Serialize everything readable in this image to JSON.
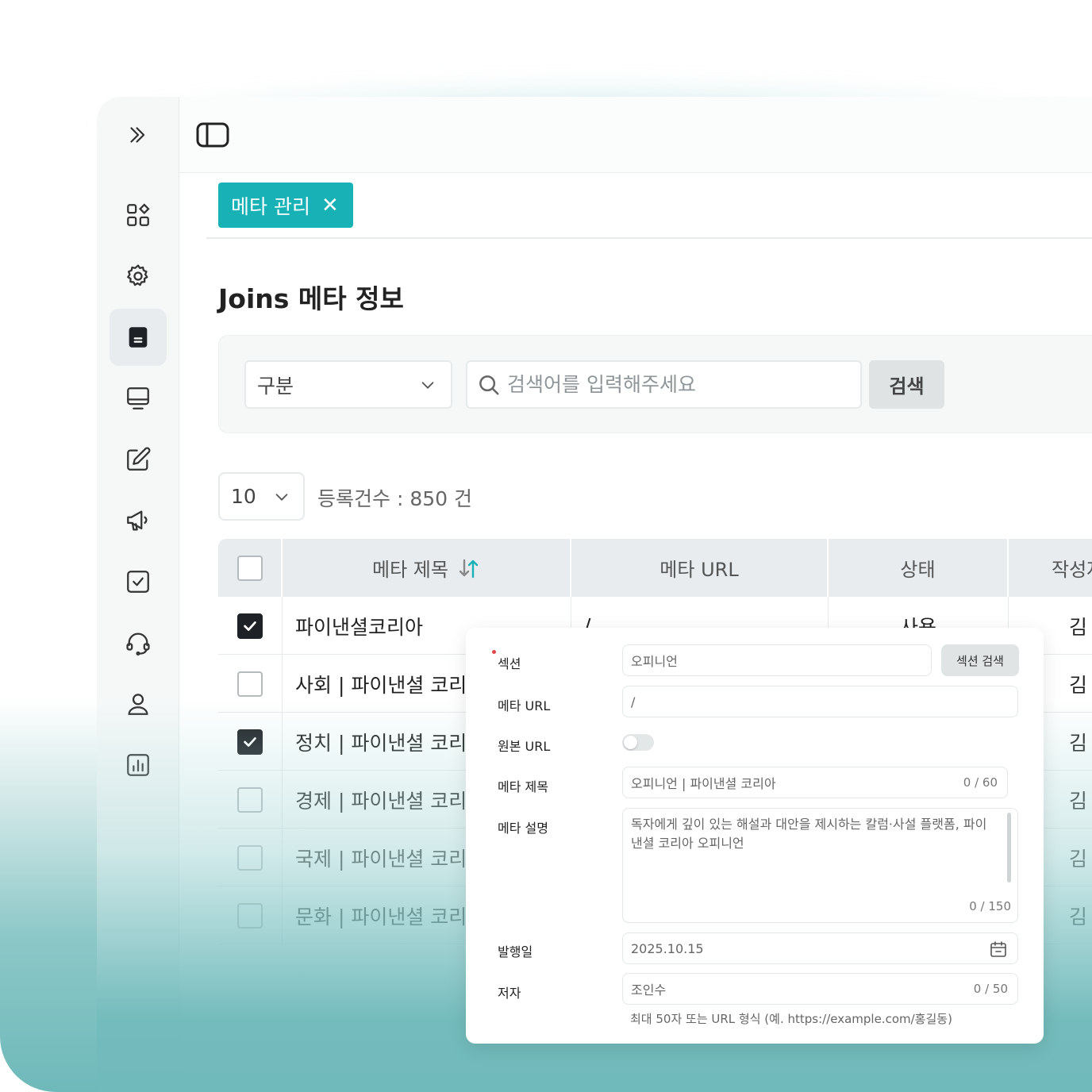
{
  "sidebar": {
    "expand_icon": "chevrons-right-icon",
    "items": [
      {
        "name": "dashboard",
        "icon": "grid-shapes-icon"
      },
      {
        "name": "settings",
        "icon": "gear-icon"
      },
      {
        "name": "document",
        "icon": "document-icon",
        "active": true
      },
      {
        "name": "monitor",
        "icon": "monitor-icon"
      },
      {
        "name": "edit",
        "icon": "edit-icon"
      },
      {
        "name": "announcement",
        "icon": "megaphone-icon"
      },
      {
        "name": "checklist",
        "icon": "checkbox-icon"
      },
      {
        "name": "support",
        "icon": "headset-icon"
      },
      {
        "name": "user",
        "icon": "user-icon"
      },
      {
        "name": "statistics",
        "icon": "bar-chart-icon"
      }
    ]
  },
  "tab": {
    "label": "메타 관리",
    "close": "✕"
  },
  "page_title": "Joins 메타 정보",
  "search": {
    "category_value": "구분",
    "placeholder": "검색어를 입력해주세요",
    "button_label": "검색"
  },
  "list": {
    "page_size": "10",
    "count_label": "등록건수 : 850 건"
  },
  "table": {
    "columns": [
      "메타 제목",
      "메타 URL",
      "상태",
      "작성자"
    ],
    "rows": [
      {
        "checked": true,
        "title": "파이낸셜코리아",
        "url": "/",
        "status": "사용",
        "author": "김"
      },
      {
        "checked": false,
        "title": "사회 | 파이낸셜 코리아",
        "url": "",
        "status": "",
        "author": "김"
      },
      {
        "checked": true,
        "title": "정치 | 파이낸셜 코리아",
        "url": "",
        "status": "",
        "author": "김"
      },
      {
        "checked": false,
        "title": "경제 | 파이낸셜 코리아",
        "url": "",
        "status": "",
        "author": "김"
      },
      {
        "checked": false,
        "title": "국제  | 파이낸셜 코리아",
        "url": "",
        "status": "",
        "author": "김"
      },
      {
        "checked": false,
        "title": "문화  | 파이낸셜 코리아",
        "url": "",
        "status": "",
        "author": "김"
      }
    ]
  },
  "modal": {
    "section": {
      "label": "섹션",
      "value": "오피니언",
      "button": "섹션 검색"
    },
    "meta_url": {
      "label": "메타 URL",
      "value": "/"
    },
    "origin_url": {
      "label": "원본 URL",
      "enabled": false
    },
    "meta_title": {
      "label": "메타 제목",
      "value": "오피니언 | 파이낸셜 코리아",
      "counter": "0 / 60"
    },
    "meta_desc": {
      "label": "메타 설명",
      "value": "독자에게 깊이 있는 해설과 대안을 제시하는 칼럼·사설 플랫폼, 파이낸셜 코리아 오피니언",
      "counter": "0 / 150"
    },
    "publish_date": {
      "label": "발행일",
      "value": "2025.10.15"
    },
    "author": {
      "label": "저자",
      "value": "조인수",
      "counter": "0 / 50",
      "hint": "최대 50자 또는 URL 형식 (예. https://example.com/홍길동)"
    }
  }
}
